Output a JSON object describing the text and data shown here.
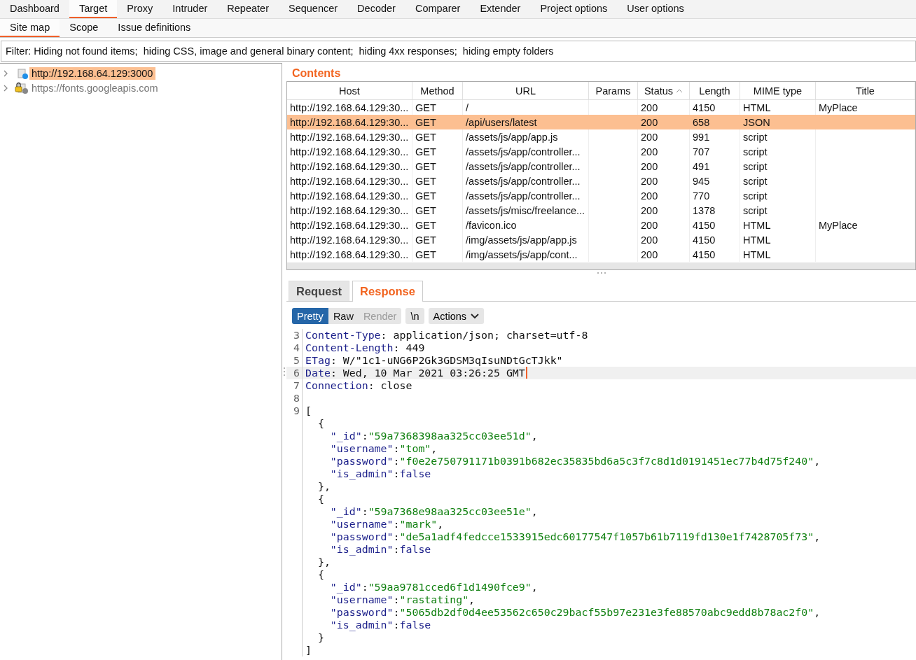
{
  "main_tabs": [
    {
      "label": "Dashboard",
      "selected": false
    },
    {
      "label": "Target",
      "selected": true
    },
    {
      "label": "Proxy",
      "selected": false
    },
    {
      "label": "Intruder",
      "selected": false
    },
    {
      "label": "Repeater",
      "selected": false
    },
    {
      "label": "Sequencer",
      "selected": false
    },
    {
      "label": "Decoder",
      "selected": false
    },
    {
      "label": "Comparer",
      "selected": false
    },
    {
      "label": "Extender",
      "selected": false
    },
    {
      "label": "Project options",
      "selected": false
    },
    {
      "label": "User options",
      "selected": false
    }
  ],
  "sub_tabs": [
    {
      "label": "Site map",
      "selected": true
    },
    {
      "label": "Scope",
      "selected": false
    },
    {
      "label": "Issue definitions",
      "selected": false
    }
  ],
  "filter": "Filter: Hiding not found items;  hiding CSS, image and general binary content;  hiding 4xx responses;  hiding empty folders",
  "site_tree": [
    {
      "label": "http://192.168.64.129:3000",
      "selected": true,
      "secure": false,
      "requested": true,
      "expanded": false
    },
    {
      "label": "https://fonts.googleapis.com",
      "selected": false,
      "secure": true,
      "requested": false,
      "expanded": false
    }
  ],
  "contents": {
    "title": "Contents",
    "columns": [
      {
        "label": "Host",
        "sorted": false
      },
      {
        "label": "Method",
        "sorted": false
      },
      {
        "label": "URL",
        "sorted": false
      },
      {
        "label": "Params",
        "sorted": false
      },
      {
        "label": "Status",
        "sorted": true
      },
      {
        "label": "Length",
        "sorted": false
      },
      {
        "label": "MIME type",
        "sorted": false
      },
      {
        "label": "Title",
        "sorted": false
      }
    ],
    "rows": [
      {
        "host": "http://192.168.64.129:30...",
        "method": "GET",
        "url": "/",
        "status": "200",
        "length": "4150",
        "mime": "HTML",
        "title": "MyPlace",
        "selected": false
      },
      {
        "host": "http://192.168.64.129:30...",
        "method": "GET",
        "url": "/api/users/latest",
        "status": "200",
        "length": "658",
        "mime": "JSON",
        "selected": true
      },
      {
        "host": "http://192.168.64.129:30...",
        "method": "GET",
        "url": "/assets/js/app/app.js",
        "status": "200",
        "length": "991",
        "mime": "script",
        "selected": false
      },
      {
        "host": "http://192.168.64.129:30...",
        "method": "GET",
        "url": "/assets/js/app/controller...",
        "status": "200",
        "length": "707",
        "mime": "script",
        "selected": false
      },
      {
        "host": "http://192.168.64.129:30...",
        "method": "GET",
        "url": "/assets/js/app/controller...",
        "status": "200",
        "length": "491",
        "mime": "script",
        "selected": false
      },
      {
        "host": "http://192.168.64.129:30...",
        "method": "GET",
        "url": "/assets/js/app/controller...",
        "status": "200",
        "length": "945",
        "mime": "script",
        "selected": false
      },
      {
        "host": "http://192.168.64.129:30...",
        "method": "GET",
        "url": "/assets/js/app/controller...",
        "status": "200",
        "length": "770",
        "mime": "script",
        "selected": false
      },
      {
        "host": "http://192.168.64.129:30...",
        "method": "GET",
        "url": "/assets/js/misc/freelance...",
        "status": "200",
        "length": "1378",
        "mime": "script",
        "selected": false
      },
      {
        "host": "http://192.168.64.129:30...",
        "method": "GET",
        "url": "/favicon.ico",
        "status": "200",
        "length": "4150",
        "mime": "HTML",
        "title": "MyPlace",
        "selected": false
      },
      {
        "host": "http://192.168.64.129:30...",
        "method": "GET",
        "url": "/img/assets/js/app/app.js",
        "status": "200",
        "length": "4150",
        "mime": "HTML",
        "selected": false
      },
      {
        "host": "http://192.168.64.129:30...",
        "method": "GET",
        "url": "/img/assets/js/app/cont...",
        "status": "200",
        "length": "4150",
        "mime": "HTML",
        "selected": false
      }
    ]
  },
  "message_tabs": [
    {
      "label": "Request",
      "selected": false
    },
    {
      "label": "Response",
      "selected": true
    }
  ],
  "view_modes": [
    {
      "label": "Pretty",
      "selected": true,
      "disabled": false
    },
    {
      "label": "Raw",
      "selected": false,
      "disabled": false
    },
    {
      "label": "Render",
      "selected": false,
      "disabled": true
    }
  ],
  "newline_button": "\\n",
  "actions_button": "Actions",
  "editor_lines": [
    {
      "number": "3",
      "current": false,
      "tokens": [
        {
          "kind": "name",
          "text": "Content-Type"
        },
        {
          "kind": "plain",
          "text": ": application/json; charset=utf-8"
        }
      ]
    },
    {
      "number": "4",
      "current": false,
      "tokens": [
        {
          "kind": "name",
          "text": "Content-Length"
        },
        {
          "kind": "plain",
          "text": ": 449"
        }
      ]
    },
    {
      "number": "5",
      "current": false,
      "tokens": [
        {
          "kind": "name",
          "text": "ETag"
        },
        {
          "kind": "plain",
          "text": ": W/\"1c1-uNG6P2Gk3GDSM3qIsuNDtGcTJkk\""
        }
      ]
    },
    {
      "number": "6",
      "current": true,
      "tokens": [
        {
          "kind": "name",
          "text": "Date"
        },
        {
          "kind": "plain",
          "text": ": Wed, 10 Mar 2021 03:26:25 GMT"
        }
      ]
    },
    {
      "number": "7",
      "current": false,
      "tokens": [
        {
          "kind": "name",
          "text": "Connection"
        },
        {
          "kind": "plain",
          "text": ": close"
        }
      ]
    },
    {
      "number": "8",
      "current": false
    },
    {
      "number": "9",
      "current": false,
      "tokens": [
        {
          "kind": "plain",
          "text": "["
        }
      ]
    },
    {
      "current": false,
      "tokens": [
        {
          "kind": "plain",
          "text": "  {"
        }
      ]
    },
    {
      "current": false,
      "tokens": [
        {
          "kind": "name",
          "text": "    \"_id\""
        },
        {
          "kind": "plain",
          "text": ":"
        },
        {
          "kind": "string",
          "text": "\"59a7368398aa325cc03ee51d\""
        },
        {
          "kind": "plain",
          "text": ","
        }
      ]
    },
    {
      "current": false,
      "tokens": [
        {
          "kind": "name",
          "text": "    \"username\""
        },
        {
          "kind": "plain",
          "text": ":"
        },
        {
          "kind": "string",
          "text": "\"tom\""
        },
        {
          "kind": "plain",
          "text": ","
        }
      ]
    },
    {
      "current": false,
      "tokens": [
        {
          "kind": "name",
          "text": "    \"password\""
        },
        {
          "kind": "plain",
          "text": ":"
        },
        {
          "kind": "string",
          "text": "\"f0e2e750791171b0391b682ec35835bd6a5c3f7c8d1d0191451ec77b4d75f240\""
        },
        {
          "kind": "plain",
          "text": ","
        }
      ]
    },
    {
      "current": false,
      "tokens": [
        {
          "kind": "name",
          "text": "    \"is_admin\""
        },
        {
          "kind": "plain",
          "text": ":"
        },
        {
          "kind": "name",
          "text": "false"
        }
      ]
    },
    {
      "current": false,
      "tokens": [
        {
          "kind": "plain",
          "text": "  },"
        }
      ]
    },
    {
      "current": false,
      "tokens": [
        {
          "kind": "plain",
          "text": "  {"
        }
      ]
    },
    {
      "current": false,
      "tokens": [
        {
          "kind": "name",
          "text": "    \"_id\""
        },
        {
          "kind": "plain",
          "text": ":"
        },
        {
          "kind": "string",
          "text": "\"59a7368e98aa325cc03ee51e\""
        },
        {
          "kind": "plain",
          "text": ","
        }
      ]
    },
    {
      "current": false,
      "tokens": [
        {
          "kind": "name",
          "text": "    \"username\""
        },
        {
          "kind": "plain",
          "text": ":"
        },
        {
          "kind": "string",
          "text": "\"mark\""
        },
        {
          "kind": "plain",
          "text": ","
        }
      ]
    },
    {
      "current": false,
      "tokens": [
        {
          "kind": "name",
          "text": "    \"password\""
        },
        {
          "kind": "plain",
          "text": ":"
        },
        {
          "kind": "string",
          "text": "\"de5a1adf4fedcce1533915edc60177547f1057b61b7119fd130e1f7428705f73\""
        },
        {
          "kind": "plain",
          "text": ","
        }
      ]
    },
    {
      "current": false,
      "tokens": [
        {
          "kind": "name",
          "text": "    \"is_admin\""
        },
        {
          "kind": "plain",
          "text": ":"
        },
        {
          "kind": "name",
          "text": "false"
        }
      ]
    },
    {
      "current": false,
      "tokens": [
        {
          "kind": "plain",
          "text": "  },"
        }
      ]
    },
    {
      "current": false,
      "tokens": [
        {
          "kind": "plain",
          "text": "  {"
        }
      ]
    },
    {
      "current": false,
      "tokens": [
        {
          "kind": "name",
          "text": "    \"_id\""
        },
        {
          "kind": "plain",
          "text": ":"
        },
        {
          "kind": "string",
          "text": "\"59aa9781cced6f1d1490fce9\""
        },
        {
          "kind": "plain",
          "text": ","
        }
      ]
    },
    {
      "current": false,
      "tokens": [
        {
          "kind": "name",
          "text": "    \"username\""
        },
        {
          "kind": "plain",
          "text": ":"
        },
        {
          "kind": "string",
          "text": "\"rastating\""
        },
        {
          "kind": "plain",
          "text": ","
        }
      ]
    },
    {
      "current": false,
      "tokens": [
        {
          "kind": "name",
          "text": "    \"password\""
        },
        {
          "kind": "plain",
          "text": ":"
        },
        {
          "kind": "string",
          "text": "\"5065db2df0d4ee53562c650c29bacf55b97e231e3fe88570abc9edd8b78ac2f0\""
        },
        {
          "kind": "plain",
          "text": ","
        }
      ]
    },
    {
      "current": false,
      "tokens": [
        {
          "kind": "name",
          "text": "    \"is_admin\""
        },
        {
          "kind": "plain",
          "text": ":"
        },
        {
          "kind": "name",
          "text": "false"
        }
      ]
    },
    {
      "current": false,
      "tokens": [
        {
          "kind": "plain",
          "text": "  }"
        }
      ]
    },
    {
      "current": false,
      "tokens": [
        {
          "kind": "plain",
          "text": "]"
        }
      ]
    }
  ]
}
